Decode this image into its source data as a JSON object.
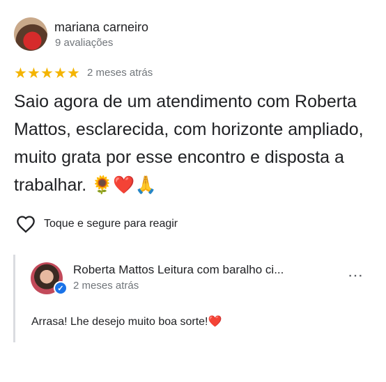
{
  "review": {
    "reviewer_name": "mariana carneiro",
    "review_count": "9 avaliações",
    "rating": 5,
    "stars": [
      "★",
      "★",
      "★",
      "★",
      "★"
    ],
    "date": "2 meses atrás",
    "text": "Saio agora de um atendimento com Roberta Mattos, esclarecida, com horizonte ampliado, muito grata por esse encontro e disposta a trabalhar. 🌻❤️🙏",
    "react_label": "Toque e segure para reagir"
  },
  "reply": {
    "owner_name": "Roberta Mattos Leitura com baralho ci...",
    "date": "2 meses atrás",
    "text": "Arrasa! Lhe desejo muito boa sorte!❤️",
    "more_icon": "⋯"
  },
  "colors": {
    "star": "#f4b400",
    "verified": "#1a73e8",
    "secondary_text": "#70757a"
  }
}
